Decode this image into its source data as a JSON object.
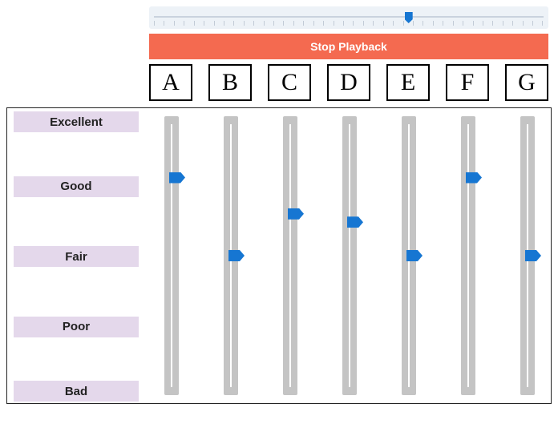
{
  "playback": {
    "slider_value": 65,
    "slider_min": 0,
    "slider_max": 100,
    "stop_label": "Stop Playback"
  },
  "columns": [
    {
      "id": "A",
      "label": "A",
      "score": 78
    },
    {
      "id": "B",
      "label": "B",
      "score": 50
    },
    {
      "id": "C",
      "label": "C",
      "score": 65
    },
    {
      "id": "D",
      "label": "D",
      "score": 62
    },
    {
      "id": "E",
      "label": "E",
      "score": 50
    },
    {
      "id": "F",
      "label": "F",
      "score": 78
    },
    {
      "id": "G",
      "label": "G",
      "score": 50
    }
  ],
  "ratings": [
    {
      "label": "Excellent",
      "value": 100
    },
    {
      "label": "Good",
      "value": 75
    },
    {
      "label": "Fair",
      "value": 50
    },
    {
      "label": "Poor",
      "value": 25
    },
    {
      "label": "Bad",
      "value": 0
    }
  ],
  "colors": {
    "accent": "#1676d2",
    "stop_button": "#f46a50",
    "rating_band": "#e4d8eb",
    "slider_rail": "#c4c4c4"
  }
}
